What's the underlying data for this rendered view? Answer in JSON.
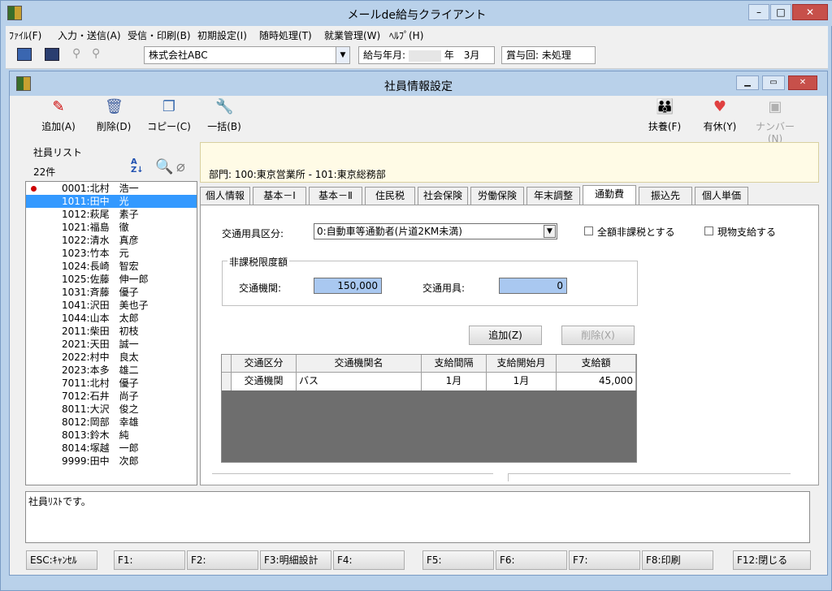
{
  "app": {
    "title": "メールde給与クライアント"
  },
  "menu": [
    "ﾌｧｲﾙ(F)",
    "入力・送信(A)",
    "受信・印刷(B)",
    "初期設定(I)",
    "随時処理(T)",
    "就業管理(W)",
    "ﾍﾙﾌﾟ(H)"
  ],
  "toolbar": {
    "company": "株式会社ABC",
    "pay_month_label": "給与年月:",
    "pay_month_value": "年　3月",
    "bonus_label": "賞与回: 未処理"
  },
  "window": {
    "title": "社員情報設定"
  },
  "actions": {
    "add": "追加(A)",
    "delete": "削除(D)",
    "copy": "コピー(C)",
    "batch": "一括(B)",
    "dependents": "扶養(F)",
    "leave": "有休(Y)",
    "number": "ナンバー(N)"
  },
  "employees": {
    "title": "社員リスト",
    "count": "22件",
    "rows": [
      "0001:北村　浩一",
      "1011:田中　光",
      "1012:萩尾　素子",
      "1021:福島　徹",
      "1022:清水　真彦",
      "1023:竹本　元",
      "1024:長崎　智宏",
      "1025:佐藤　伸一郎",
      "1031:斉藤　優子",
      "1041:沢田　美也子",
      "1044:山本　太郎",
      "2011:柴田　初枝",
      "2021:天田　誠一",
      "2022:村中　良太",
      "2023:本多　雄二",
      "7011:北村　優子",
      "7012:石井　尚子",
      "8011:大沢　俊之",
      "8012:岡部　幸雄",
      "8013:鈴木　純",
      "8014:塚越　一郎",
      "9999:田中　次郎"
    ]
  },
  "dept": "部門:  100:東京営業所 - 101:東京総務部",
  "tabs": [
    "個人情報",
    "基本－Ⅰ",
    "基本－Ⅱ",
    "住民税",
    "社会保険",
    "労働保険",
    "年末調整",
    "通勤費",
    "振込先",
    "個人単価"
  ],
  "commute": {
    "type_label": "交通用具区分:",
    "type_value": "0:自動車等通勤者(片道2KM未満)",
    "all_taxable_label": "全額非課税とする",
    "in_kind_label": "現物支給する",
    "limit_group": "非課税限度額",
    "transport_label": "交通機関:",
    "transport_value": "150,000",
    "tool_label": "交通用具:",
    "tool_value": "0",
    "add_button": "追加(Z)",
    "delete_button": "削除(X)"
  },
  "grid": {
    "headers": [
      "交通区分",
      "交通機関名",
      "支給間隔",
      "支給開始月",
      "支給額"
    ],
    "row": [
      "交通機関",
      "バス",
      "1月",
      "1月",
      "45,000"
    ]
  },
  "status": "社員ﾘｽﾄです。",
  "fkeys": [
    "ESC:ｷｬﾝｾﾙ",
    "F1:",
    "F2:",
    "F3:明細設計",
    "F4:",
    "F5:",
    "F6:",
    "F7:",
    "F8:印刷",
    "F12:閉じる"
  ]
}
